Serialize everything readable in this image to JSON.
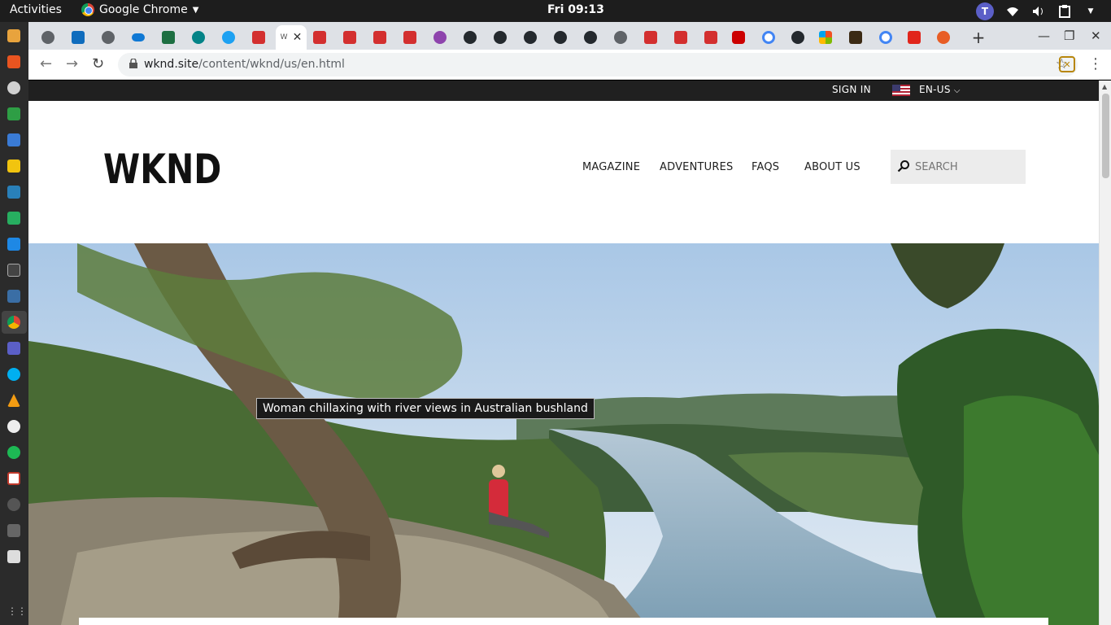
{
  "os": {
    "activities": "Activities",
    "app_name": "Google Chrome",
    "clock": "Fri 09:13",
    "teams_letter": "T"
  },
  "browser": {
    "url_host": "wknd.site",
    "url_path": "/content/wknd/us/en.html",
    "active_tab_title": "W"
  },
  "site": {
    "utility": {
      "sign_in": "SIGN IN",
      "language": "EN-US"
    },
    "logo": "WKND",
    "nav": [
      "MAGAZINE",
      "ADVENTURES",
      "FAQS",
      "ABOUT US"
    ],
    "search_placeholder": "SEARCH",
    "hero": {
      "tooltip": "Woman chillaxing with river views in Australian bushland"
    }
  },
  "colors": {
    "util_bar": "#202020",
    "search_bg": "#ececec",
    "tab_red": "#d32f2f",
    "github": "#24292e"
  }
}
